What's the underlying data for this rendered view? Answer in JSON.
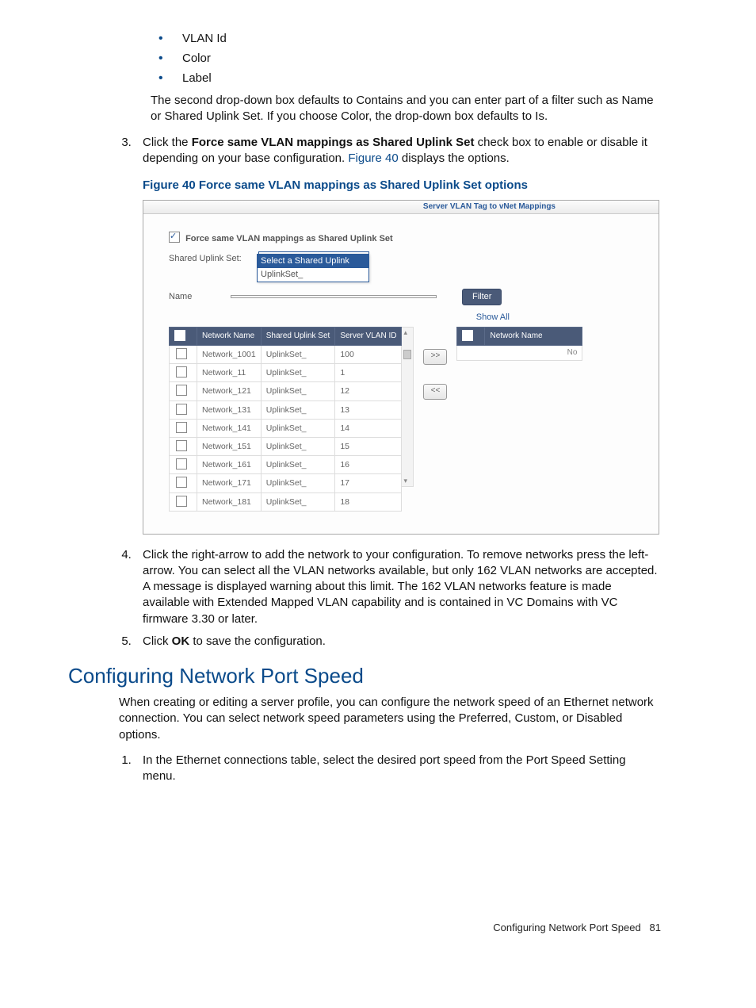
{
  "bullets": [
    "VLAN Id",
    "Color",
    "Label"
  ],
  "para_dropdown_default": "The second drop-down box defaults to Contains and you can enter part of a filter such as Name or Shared Uplink Set. If you choose Color, the drop-down box defaults to Is.",
  "step3": {
    "pre": "Click the ",
    "bold": "Force same VLAN mappings as Shared Uplink Set",
    "mid": " check box to enable or disable it depending on your base configuration. ",
    "link": "Figure 40",
    "post": " displays the options."
  },
  "fig40_caption": "Figure 40 Force same VLAN mappings as Shared Uplink Set options",
  "fig": {
    "title_tab": "Server VLAN Tag to vNet Mappings",
    "force_label": "Force same VLAN mappings as Shared Uplink Set",
    "sus_label": "Shared Uplink Set:",
    "sus_selected": "Select a Shared Uplink",
    "dropdown_opt1": "Select a Shared Uplink",
    "dropdown_opt2": "UplinkSet_",
    "name_label": "Name",
    "name_value": "",
    "filter_btn": "Filter",
    "show_all": "Show All",
    "left_headers": [
      "",
      "Network Name",
      "Shared Uplink Set",
      "Server VLAN ID"
    ],
    "right_headers": [
      "",
      "Network Name"
    ],
    "right_empty": "No",
    "move_right": ">>",
    "move_left": "<<",
    "rows": [
      {
        "name": "Network_1001",
        "sus": "UplinkSet_",
        "vlan": "100"
      },
      {
        "name": "Network_11",
        "sus": "UplinkSet_",
        "vlan": "1"
      },
      {
        "name": "Network_121",
        "sus": "UplinkSet_",
        "vlan": "12"
      },
      {
        "name": "Network_131",
        "sus": "UplinkSet_",
        "vlan": "13"
      },
      {
        "name": "Network_141",
        "sus": "UplinkSet_",
        "vlan": "14"
      },
      {
        "name": "Network_151",
        "sus": "UplinkSet_",
        "vlan": "15"
      },
      {
        "name": "Network_161",
        "sus": "UplinkSet_",
        "vlan": "16"
      },
      {
        "name": "Network_171",
        "sus": "UplinkSet_",
        "vlan": "17"
      },
      {
        "name": "Network_181",
        "sus": "UplinkSet_",
        "vlan": "18"
      }
    ]
  },
  "step4": "Click the right-arrow to add the network to your configuration. To remove networks press the left-arrow. You can select all the VLAN networks available, but only 162 VLAN networks are accepted. A message is displayed warning about this limit. The 162 VLAN networks feature is made available with Extended Mapped VLAN capability and is contained in VC Domains with VC firmware 3.30 or later.",
  "step5": {
    "pre": "Click ",
    "bold": "OK",
    "post": " to save the configuration."
  },
  "section_heading": "Configuring Network Port Speed",
  "section_para": "When creating or editing a server profile, you can configure the network speed of an Ethernet network connection. You can select network speed parameters using the Preferred, Custom, or Disabled options.",
  "section_step1": "In the Ethernet connections table, select the desired port speed from the Port Speed Setting menu.",
  "footer": "Configuring Network Port Speed",
  "page_no": "81"
}
